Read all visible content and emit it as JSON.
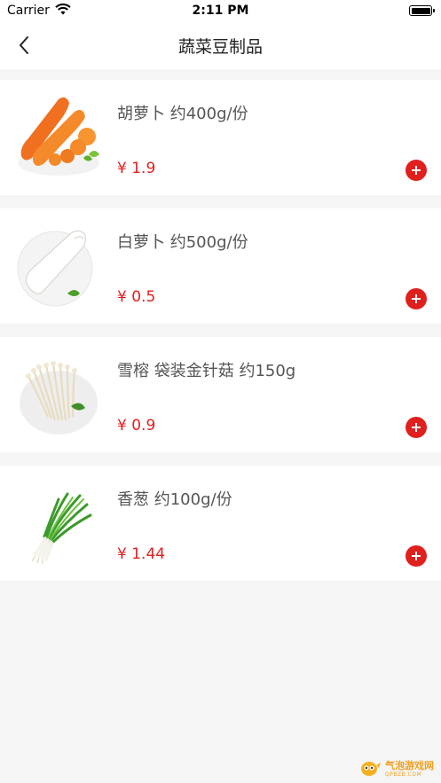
{
  "status": {
    "carrier": "Carrier",
    "time": "2:11 PM"
  },
  "nav": {
    "title": "蔬菜豆制品",
    "back_icon": "chevron-left-icon"
  },
  "items": [
    {
      "name": "胡萝卜 约400g/份",
      "price": "¥ 1.9",
      "image": "carrot"
    },
    {
      "name": "白萝卜 约500g/份",
      "price": "¥ 0.5",
      "image": "white-radish"
    },
    {
      "name": "雪榕 袋装金针菇 约150g",
      "price": "¥ 0.9",
      "image": "enoki-mushroom"
    },
    {
      "name": "香葱 约100g/份",
      "price": "¥ 1.44",
      "image": "scallion"
    }
  ],
  "watermark": {
    "text": "气泡游戏网",
    "sub": "QPBZB.COM"
  },
  "colors": {
    "accent": "#e0201e",
    "background": "#f5f5f5",
    "card": "#ffffff"
  }
}
